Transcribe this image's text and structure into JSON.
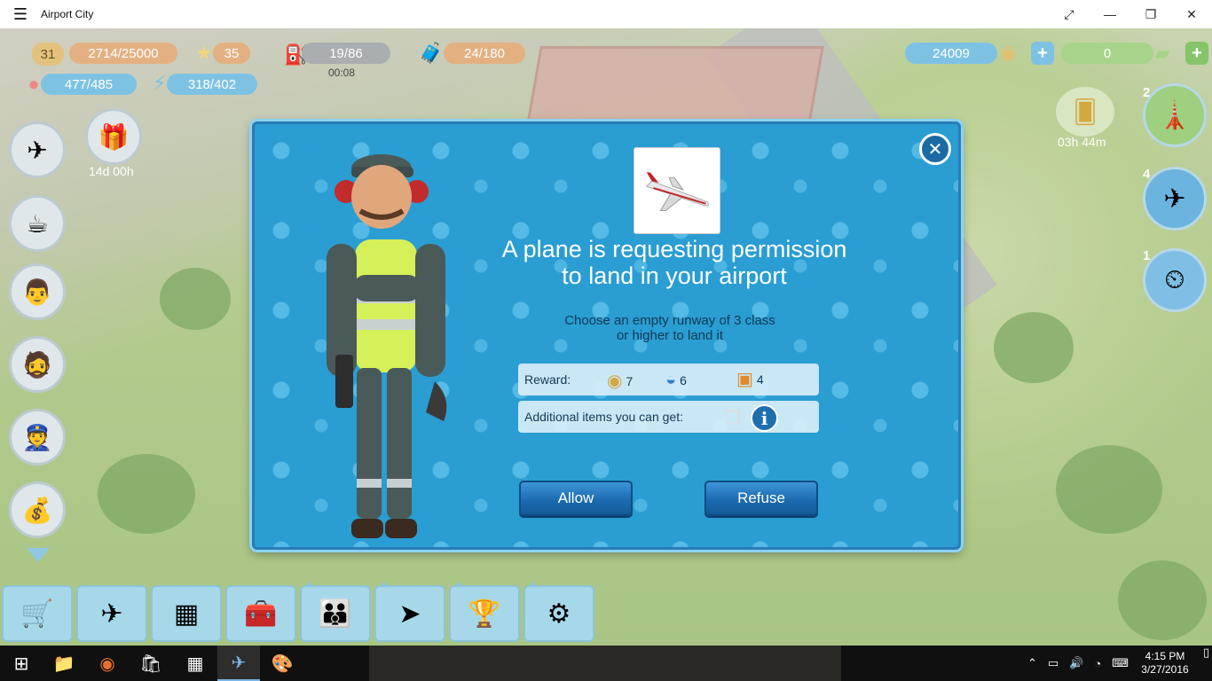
{
  "window": {
    "title": "Airport City",
    "menu_icon": "hamburger-icon",
    "controls": [
      "fullscreen-icon",
      "minimize-icon",
      "restore-icon",
      "close-icon"
    ]
  },
  "hud": {
    "level": "31",
    "experience": "2714/25000",
    "stars": "35",
    "fuel": "19/86",
    "fuel_timer": "00:08",
    "cargo": "24/180",
    "population": "477/485",
    "energy": "318/402",
    "coins": "24009",
    "airdollars": "0",
    "left_timer": "14d 00h",
    "right_timer": "03h 44m",
    "right_badges": [
      "2",
      "4",
      "1"
    ]
  },
  "dialog": {
    "title_line1": "A plane is requesting permission",
    "title_line2": "to land in your airport",
    "subtitle_line1": "Choose an empty runway of 3 class",
    "subtitle_line2": "or higher to land it",
    "reward_label": "Reward:",
    "rewards": [
      {
        "icon": "coins-icon",
        "value": "7"
      },
      {
        "icon": "pilot-cap-icon",
        "value": "6"
      },
      {
        "icon": "luggage-icon",
        "value": "4"
      }
    ],
    "additional_label": "Additional items you can get:",
    "allow_label": "Allow",
    "refuse_label": "Refuse"
  },
  "taskbar": {
    "time": "4:15 PM",
    "date": "3/27/2016"
  },
  "colors": {
    "dialog_bg": "#2a9dd3",
    "button_blue": "#1c6bb0",
    "taskbar": "#101010"
  }
}
